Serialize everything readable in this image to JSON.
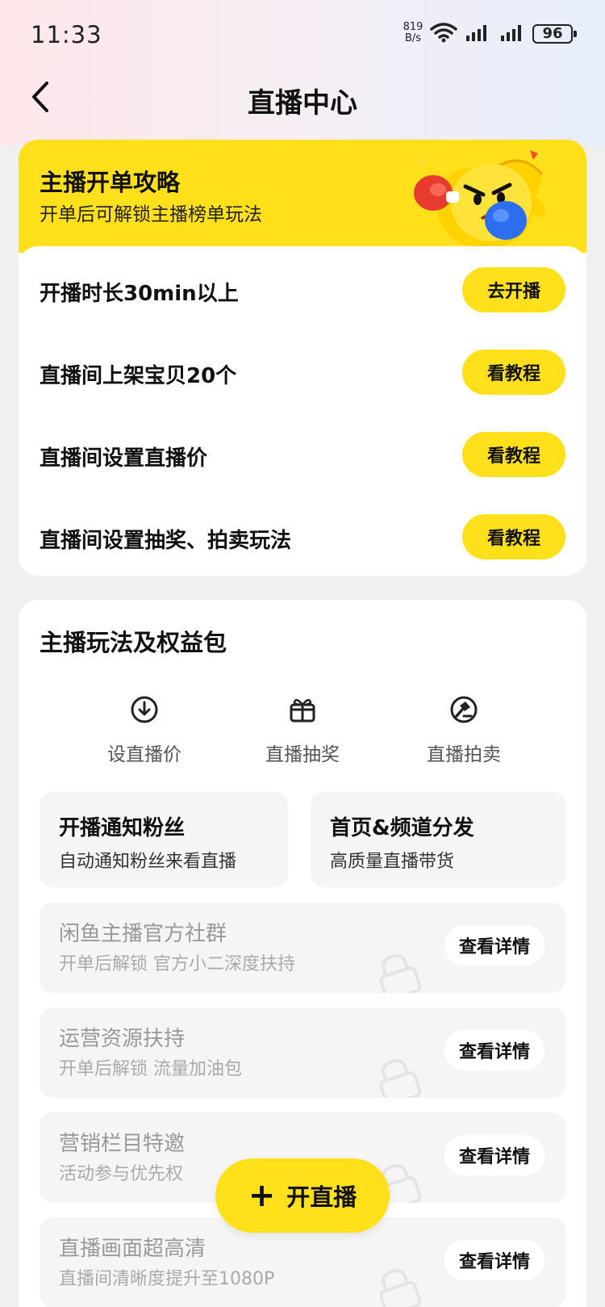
{
  "status_bar": {
    "time": "11:33",
    "net_speed_value": "819",
    "net_speed_unit": "B/s",
    "battery": "96"
  },
  "nav": {
    "title": "直播中心",
    "back_icon": "chevron-left-icon"
  },
  "strategy_card": {
    "title": "主播开单攻略",
    "subtitle": "开单后可解锁主播榜单玩法",
    "accent_color": "#ffe01b",
    "tasks": [
      {
        "label": "开播时长30min以上",
        "button": "去开播"
      },
      {
        "label": "直播间上架宝贝20个",
        "button": "看教程"
      },
      {
        "label": "直播间设置直播价",
        "button": "看教程"
      },
      {
        "label": "直播间设置抽奖、拍卖玩法",
        "button": "看教程"
      }
    ]
  },
  "benefits_card": {
    "title": "主播玩法及权益包",
    "tools": [
      {
        "label": "设直播价",
        "icon": "download-circle-icon"
      },
      {
        "label": "直播抽奖",
        "icon": "gift-icon"
      },
      {
        "label": "直播拍卖",
        "icon": "gavel-icon"
      }
    ],
    "perks": [
      {
        "title": "开播通知粉丝",
        "subtitle": "自动通知粉丝来看直播"
      },
      {
        "title": "首页&频道分发",
        "subtitle": "高质量直播带货"
      }
    ],
    "locked": [
      {
        "title": "闲鱼主播官方社群",
        "subtitle": "开单后解锁 官方小二深度扶持",
        "button": "查看详情"
      },
      {
        "title": "运营资源扶持",
        "subtitle": "开单后解锁 流量加油包",
        "button": "查看详情"
      },
      {
        "title": "营销栏目特邀",
        "subtitle": "活动参与优先权",
        "button": "查看详情"
      },
      {
        "title": "直播画面超高清",
        "subtitle": "直播间清晰度提升至1080P",
        "button": "查看详情"
      }
    ]
  },
  "fab": {
    "plus": "+",
    "label": "开直播"
  }
}
